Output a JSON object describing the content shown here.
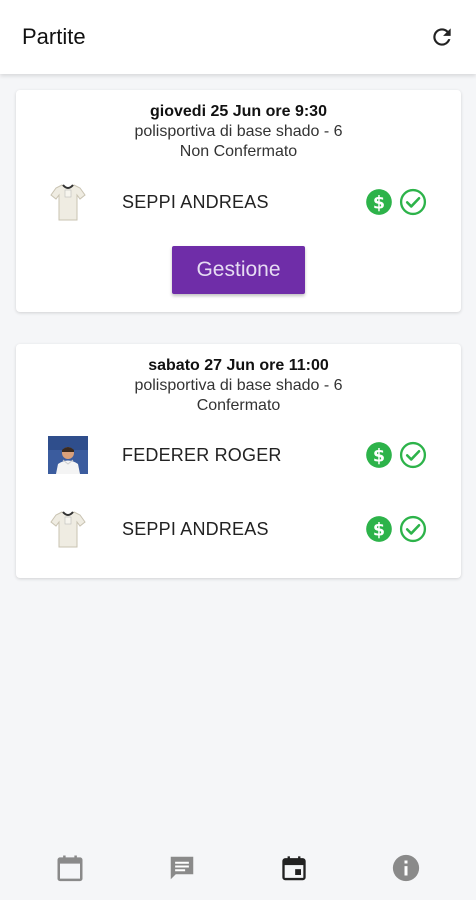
{
  "app_bar": {
    "title": "Partite",
    "refresh_icon": "refresh-icon"
  },
  "matches": [
    {
      "date": "giovedi 25 Jun ore 9:30",
      "venue": "polisportiva di base shado - 6",
      "status": "Non Confermato",
      "players": [
        {
          "name": "SEPPI ANDREAS",
          "avatar": "shirt-avatar",
          "paid": true,
          "confirmed": true
        }
      ],
      "action_label": "Gestione"
    },
    {
      "date": "sabato 27 Jun ore 11:00",
      "venue": "polisportiva di base shado - 6",
      "status": "Confermato",
      "players": [
        {
          "name": "FEDERER ROGER",
          "avatar": "photo-avatar",
          "paid": true,
          "confirmed": true
        },
        {
          "name": "SEPPI ANDREAS",
          "avatar": "shirt-avatar",
          "paid": true,
          "confirmed": true
        }
      ]
    }
  ],
  "bottom_nav": [
    "calendar-outline-icon",
    "chat-icon",
    "calendar-event-icon",
    "info-icon"
  ],
  "colors": {
    "accent": "#6f2da8",
    "status_green": "#2db34a",
    "nav_grey": "#8a8a8a"
  }
}
